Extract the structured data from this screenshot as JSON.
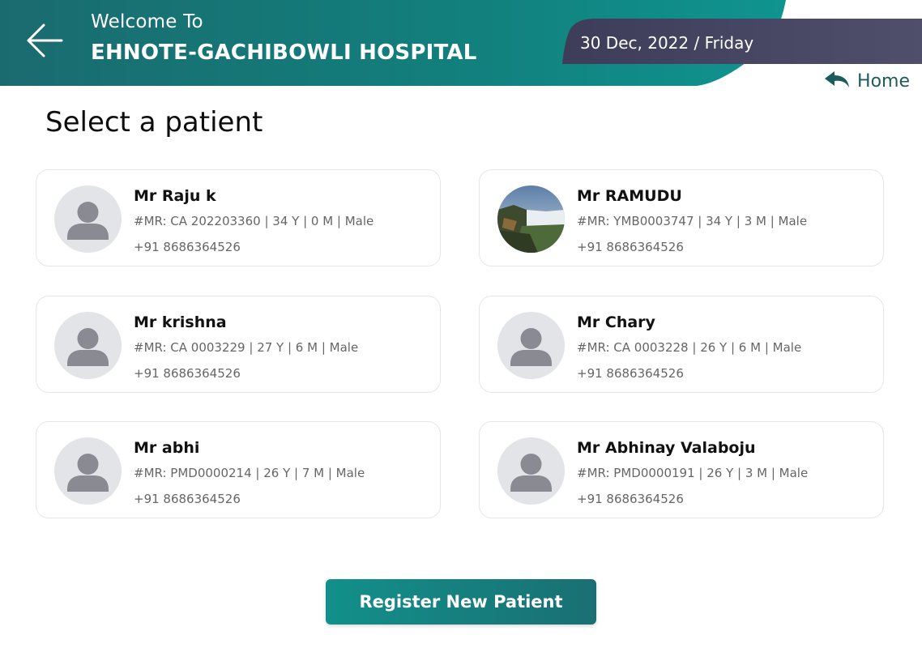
{
  "header": {
    "welcome": "Welcome To",
    "hospital": "EHNOTE-GACHIBOWLI HOSPITAL",
    "date": "30 Dec, 2022 / Friday",
    "home_label": "Home",
    "icons": {
      "back": "arrow-left-icon",
      "home": "reply-arrow-icon"
    },
    "colors": {
      "header_teal": "#12827f",
      "date_band": "#4a4a66"
    }
  },
  "page": {
    "title": "Select a patient"
  },
  "patients": [
    {
      "name": "Mr Raju k",
      "meta": "#MR: CA 202203360 | 34 Y | 0 M | Male",
      "phone": "+91 8686364526",
      "avatar": "placeholder-person"
    },
    {
      "name": "Mr RAMUDU",
      "meta": "#MR: YMB0003747 | 34 Y | 3 M | Male",
      "phone": "+91 8686364526",
      "avatar": "waterfall-photo"
    },
    {
      "name": "Mr krishna",
      "meta": "#MR: CA 0003229 | 27 Y | 6 M | Male",
      "phone": "+91 8686364526",
      "avatar": "placeholder-person"
    },
    {
      "name": "Mr Chary",
      "meta": "#MR: CA 0003228 | 26 Y | 6 M | Male",
      "phone": "+91 8686364526",
      "avatar": "placeholder-person"
    },
    {
      "name": "Mr abhi",
      "meta": "#MR: PMD0000214 | 26 Y | 7 M | Male",
      "phone": "+91 8686364526",
      "avatar": "placeholder-person"
    },
    {
      "name": "Mr Abhinay Valaboju",
      "meta": "#MR: PMD0000191 | 26 Y | 3 M | Male",
      "phone": "+91 8686364526",
      "avatar": "placeholder-person"
    }
  ],
  "actions": {
    "register_label": "Register New Patient"
  }
}
